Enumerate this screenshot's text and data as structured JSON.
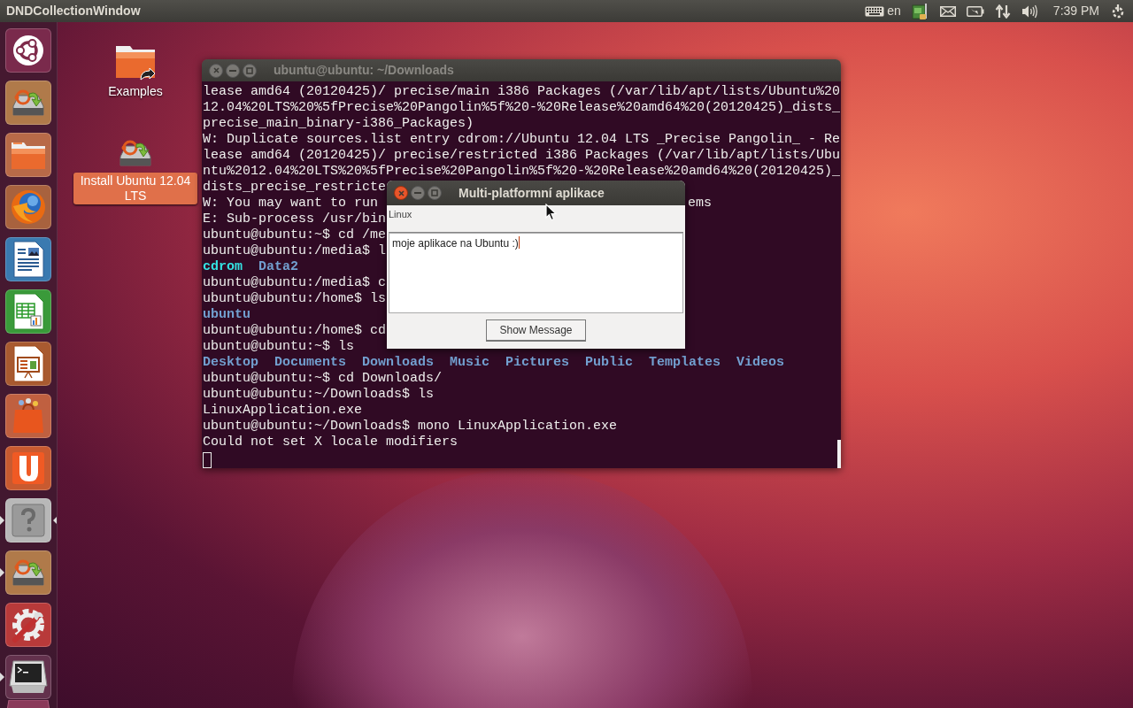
{
  "top_panel": {
    "title": "DNDCollectionWindow",
    "keyboard_layout": "en",
    "clock": "7:39 PM"
  },
  "launcher": [
    {
      "kind": "dash",
      "running": false,
      "focused": false
    },
    {
      "kind": "installer",
      "running": false,
      "focused": false
    },
    {
      "kind": "files",
      "running": false,
      "focused": false
    },
    {
      "kind": "browser",
      "running": false,
      "focused": false
    },
    {
      "kind": "writer",
      "running": false,
      "focused": false
    },
    {
      "kind": "calc",
      "running": false,
      "focused": false
    },
    {
      "kind": "impress",
      "running": false,
      "focused": false
    },
    {
      "kind": "store",
      "running": false,
      "focused": false
    },
    {
      "kind": "cloud",
      "running": false,
      "focused": false
    },
    {
      "kind": "unknown",
      "running": true,
      "focused": true
    },
    {
      "kind": "installer",
      "running": true,
      "focused": false
    },
    {
      "kind": "settings",
      "running": false,
      "focused": false
    },
    {
      "kind": "terminal",
      "running": true,
      "focused": false
    }
  ],
  "desktop_icons": [
    {
      "kind": "folder",
      "label": "Examples",
      "selected": false
    },
    {
      "kind": "installer",
      "label": "Install Ubuntu 12.04 LTS",
      "selected": true
    }
  ],
  "terminal": {
    "title": "ubuntu@ubuntu: ~/Downloads",
    "focused": false,
    "lines": [
      {
        "text": "lease amd64 (20120425)/ precise/main i386 Packages (/var/lib/apt/lists/Ubuntu%20"
      },
      {
        "text": "12.04%20LTS%20%5fPrecise%20Pangolin%5f%20-%20Release%20amd64%20(20120425)_dists_"
      },
      {
        "text": "precise_main_binary-i386_Packages)"
      },
      {
        "text": "W: Duplicate sources.list entry cdrom://Ubuntu 12.04 LTS _Precise Pangolin_ - Re"
      },
      {
        "text": "lease amd64 (20120425)/ precise/restricted i386 Packages (/var/lib/apt/lists/Ubu"
      },
      {
        "text": "ntu%2012.04%20LTS%20%5fPrecise%20Pangolin%5f%20-%20Release%20amd64%20(20120425)_"
      },
      {
        "text": "dists_precise_restricte"
      },
      {
        "text": "W: You may want to run",
        "tail": "ems"
      },
      {
        "text": "E: Sub-process /usr/bin"
      },
      {
        "text": "ubuntu@ubuntu:~$ cd /me"
      },
      {
        "text": "ubuntu@ubuntu:/media$ l"
      },
      {
        "items": [
          {
            "text": "cdrom",
            "color": "#34e2e2"
          },
          {
            "text": "Data2",
            "color": "#729fcf"
          }
        ]
      },
      {
        "text": "ubuntu@ubuntu:/media$ c"
      },
      {
        "text": "ubuntu@ubuntu:/home$ ls"
      },
      {
        "items": [
          {
            "text": "ubuntu",
            "color": "#729fcf"
          }
        ]
      },
      {
        "text": "ubuntu@ubuntu:/home$ cd"
      },
      {
        "text": "ubuntu@ubuntu:~$ ls"
      },
      {
        "items": [
          {
            "text": "Desktop",
            "color": "#729fcf"
          },
          {
            "text": "Documents",
            "color": "#729fcf"
          },
          {
            "text": "Downloads",
            "color": "#729fcf"
          },
          {
            "text": "Music",
            "color": "#729fcf"
          },
          {
            "text": "Pictures",
            "color": "#729fcf"
          },
          {
            "text": "Public",
            "color": "#729fcf"
          },
          {
            "text": "Templates",
            "color": "#729fcf"
          },
          {
            "text": "Videos",
            "color": "#729fcf"
          }
        ]
      },
      {
        "text": "ubuntu@ubuntu:~$ cd Downloads/"
      },
      {
        "text": "ubuntu@ubuntu:~/Downloads$ ls"
      },
      {
        "text": "LinuxApplication.exe"
      },
      {
        "text": "ubuntu@ubuntu:~/Downloads$ mono LinuxApplication.exe"
      },
      {
        "text": "Could not set X locale modifiers"
      }
    ]
  },
  "dialog": {
    "title": "Multi-platformní aplikace",
    "focused": true,
    "label": "Linux",
    "text_value": "moje aplikace na Ubuntu :)",
    "button": "Show Message"
  }
}
